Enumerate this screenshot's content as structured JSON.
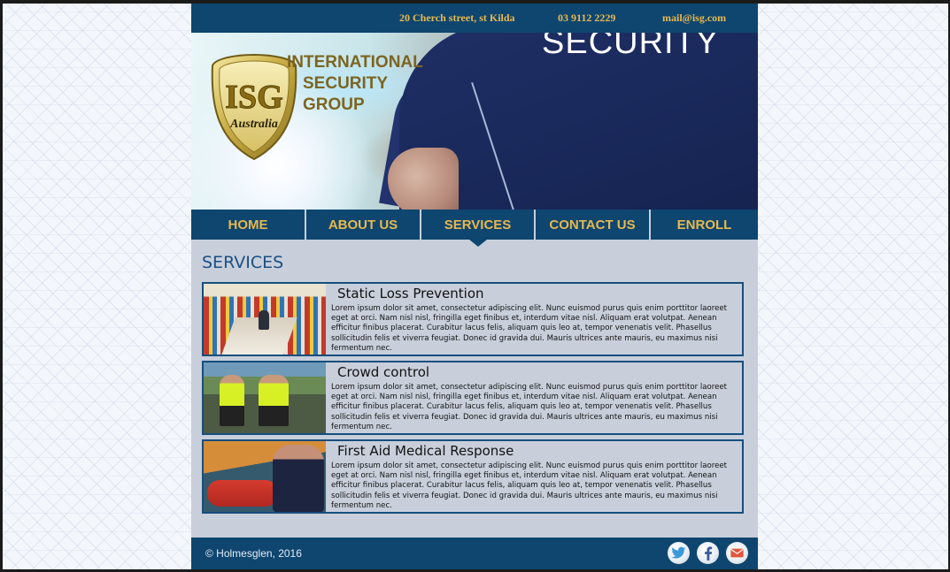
{
  "topbar": {
    "address": "20 Cherch street, st Kilda",
    "phone": "03 9112 2229",
    "email": "mail@isg.com"
  },
  "banner": {
    "shirt_text": "SECURITY",
    "logo_badge_text": "ISG",
    "logo_badge_subtext": "Australia",
    "logo_lines": [
      "INTERNATIONAL",
      "SECURITY",
      "GROUP"
    ]
  },
  "nav": {
    "items": [
      {
        "label": "HOME"
      },
      {
        "label": "ABOUT US"
      },
      {
        "label": "SERVICES",
        "active": true
      },
      {
        "label": "CONTACT US"
      },
      {
        "label": "ENROLL"
      }
    ]
  },
  "main": {
    "title": "SERVICES",
    "services": [
      {
        "title": "Static Loss Prevention",
        "body": "Lorem ipsum dolor sit amet, consectetur adipiscing elit. Nunc euismod purus quis enim porttitor laoreet eget at orci. Nam nisl nisl, fringilla eget finibus et, interdum vitae nisl. Aliquam erat volutpat. Aenean efficitur finibus placerat. Curabitur lacus felis, aliquam quis leo at, tempor venenatis velit. Phasellus sollicitudin felis et viverra feugiat. Donec id gravida dui. Mauris ultrices ante mauris, eu maximus nisi fermentum nec."
      },
      {
        "title": "Crowd control",
        "body": "Lorem ipsum dolor sit amet, consectetur adipiscing elit. Nunc euismod purus quis enim porttitor laoreet eget at orci. Nam nisl nisl, fringilla eget finibus et, interdum vitae nisl. Aliquam erat volutpat. Aenean efficitur finibus placerat. Curabitur lacus felis, aliquam quis leo at, tempor venenatis velit. Phasellus sollicitudin felis et viverra feugiat. Donec id gravida dui. Mauris ultrices ante mauris, eu maximus nisi fermentum nec."
      },
      {
        "title": "First Aid Medical Response",
        "body": "Lorem ipsum dolor sit amet, consectetur adipiscing elit. Nunc euismod purus quis enim porttitor laoreet eget at orci. Nam nisl nisl, fringilla eget finibus et, interdum vitae nisl. Aliquam erat volutpat. Aenean efficitur finibus placerat. Curabitur lacus felis, aliquam quis leo at, tempor venenatis velit. Phasellus sollicitudin felis et viverra feugiat. Donec id gravida dui. Mauris ultrices ante mauris, eu maximus nisi fermentum nec."
      }
    ]
  },
  "footer": {
    "copyright": "© Holmesglen, 2016",
    "social_icons": [
      "twitter-icon",
      "facebook-icon",
      "mail-icon"
    ]
  },
  "colors": {
    "brand_navy": "#0e4670",
    "accent_gold": "#e8b84e",
    "panel_bg": "#c8cfdb"
  }
}
